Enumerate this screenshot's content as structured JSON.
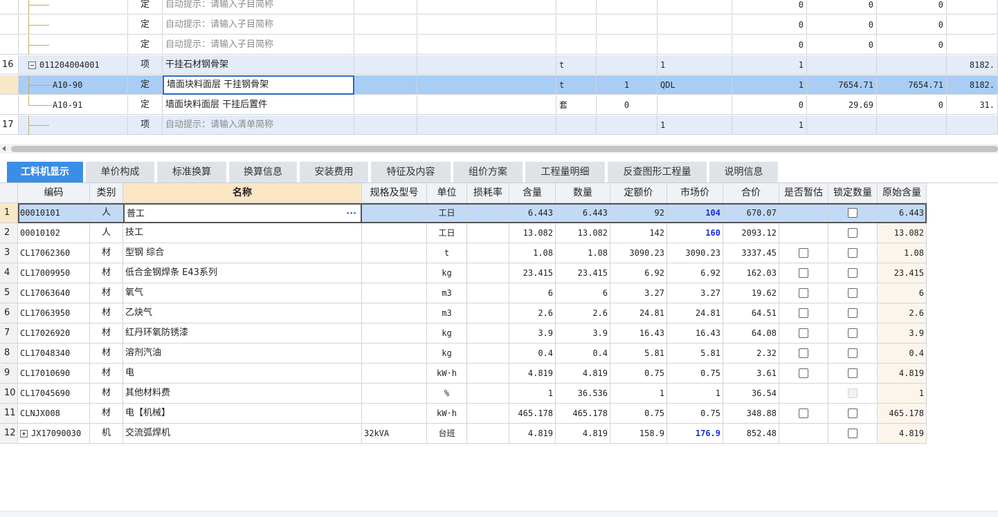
{
  "top_rows": [
    {
      "rn": "",
      "code": "",
      "type": "定",
      "name": "自动提示：请输入子目简称",
      "name_hint": true,
      "unit": "",
      "qty": "",
      "expr": "",
      "c9": "0",
      "c10": "0",
      "c11": "0",
      "c12": "",
      "style": "",
      "tree": "child"
    },
    {
      "rn": "",
      "code": "",
      "type": "定",
      "name": "自动提示：请输入子目简称",
      "name_hint": true,
      "unit": "",
      "qty": "",
      "expr": "",
      "c9": "0",
      "c10": "0",
      "c11": "0",
      "c12": "",
      "style": "",
      "tree": "child"
    },
    {
      "rn": "",
      "code": "",
      "type": "定",
      "name": "自动提示：请输入子目简称",
      "name_hint": true,
      "unit": "",
      "qty": "",
      "expr": "",
      "c9": "0",
      "c10": "0",
      "c11": "0",
      "c12": "",
      "style": "",
      "tree": "child"
    },
    {
      "rn": "16",
      "code": "011204004001",
      "type": "项",
      "name": "干挂石材钢骨架",
      "name_hint": false,
      "unit": "t",
      "qty": "",
      "expr": "1",
      "c9": "1",
      "c10": "",
      "c11": "",
      "c12": "8182.",
      "style": "alt",
      "tree": "parent"
    },
    {
      "rn": "",
      "code": "A10-90",
      "type": "定",
      "name": "墙面块料面层 干挂钢骨架",
      "name_hint": false,
      "unit": "t",
      "qty": "1",
      "expr": "QDL",
      "c9": "1",
      "c10": "7654.71",
      "c11": "7654.71",
      "c12": "8182.",
      "style": "sel",
      "tree": "child2"
    },
    {
      "rn": "",
      "code": "A10-91",
      "type": "定",
      "name": "墙面块料面层 干挂后置件",
      "name_hint": false,
      "unit": "套",
      "qty": "0",
      "expr": "",
      "c9": "0",
      "c10": "29.69",
      "c11": "0",
      "c12": "31.",
      "style": "",
      "tree": "child2"
    },
    {
      "rn": "17",
      "code": "",
      "type": "项",
      "name": "自动提示：请输入清单简称",
      "name_hint": true,
      "unit": "",
      "qty": "",
      "expr": "1",
      "c9": "1",
      "c10": "",
      "c11": "",
      "c12": "",
      "style": "alt",
      "tree": "child"
    }
  ],
  "tabs": [
    "工料机显示",
    "单价构成",
    "标准换算",
    "换算信息",
    "安装费用",
    "特征及内容",
    "组价方案",
    "工程量明细",
    "反查图形工程量",
    "说明信息"
  ],
  "active_tab": "工料机显示",
  "headers": [
    "",
    "编码",
    "类别",
    "名称",
    "规格及型号",
    "单位",
    "损耗率",
    "含量",
    "数量",
    "定额价",
    "市场价",
    "合价",
    "是否暂估",
    "锁定数量",
    "原始含量"
  ],
  "rows": [
    {
      "rn": "1",
      "code": "00010101",
      "cat": "人",
      "name": "普工",
      "spec": "",
      "unit": "工日",
      "loss": "",
      "content": "6.443",
      "qty": "6.443",
      "price": "92",
      "market": "104",
      "total": "670.07",
      "est": "none",
      "lock": "box",
      "orig": "6.443",
      "market_blue": true,
      "expand": false
    },
    {
      "rn": "2",
      "code": "00010102",
      "cat": "人",
      "name": "技工",
      "spec": "",
      "unit": "工日",
      "loss": "",
      "content": "13.082",
      "qty": "13.082",
      "price": "142",
      "market": "160",
      "total": "2093.12",
      "est": "none",
      "lock": "box",
      "orig": "13.082",
      "market_blue": true,
      "expand": false
    },
    {
      "rn": "3",
      "code": "CL17062360",
      "cat": "材",
      "name": "型钢 综合",
      "spec": "",
      "unit": "t",
      "loss": "",
      "content": "1.08",
      "qty": "1.08",
      "price": "3090.23",
      "market": "3090.23",
      "total": "3337.45",
      "est": "box",
      "lock": "box",
      "orig": "1.08",
      "market_blue": false,
      "expand": false
    },
    {
      "rn": "4",
      "code": "CL17009950",
      "cat": "材",
      "name": "低合金钢焊条 E43系列",
      "spec": "",
      "unit": "kg",
      "loss": "",
      "content": "23.415",
      "qty": "23.415",
      "price": "6.92",
      "market": "6.92",
      "total": "162.03",
      "est": "box",
      "lock": "box",
      "orig": "23.415",
      "market_blue": false,
      "expand": false
    },
    {
      "rn": "5",
      "code": "CL17063640",
      "cat": "材",
      "name": "氧气",
      "spec": "",
      "unit": "m3",
      "loss": "",
      "content": "6",
      "qty": "6",
      "price": "3.27",
      "market": "3.27",
      "total": "19.62",
      "est": "box",
      "lock": "box",
      "orig": "6",
      "market_blue": false,
      "expand": false
    },
    {
      "rn": "6",
      "code": "CL17063950",
      "cat": "材",
      "name": "乙炔气",
      "spec": "",
      "unit": "m3",
      "loss": "",
      "content": "2.6",
      "qty": "2.6",
      "price": "24.81",
      "market": "24.81",
      "total": "64.51",
      "est": "box",
      "lock": "box",
      "orig": "2.6",
      "market_blue": false,
      "expand": false
    },
    {
      "rn": "7",
      "code": "CL17026920",
      "cat": "材",
      "name": "红丹环氧防锈漆",
      "spec": "",
      "unit": "kg",
      "loss": "",
      "content": "3.9",
      "qty": "3.9",
      "price": "16.43",
      "market": "16.43",
      "total": "64.08",
      "est": "box",
      "lock": "box",
      "orig": "3.9",
      "market_blue": false,
      "expand": false
    },
    {
      "rn": "8",
      "code": "CL17048340",
      "cat": "材",
      "name": "溶剂汽油",
      "spec": "",
      "unit": "kg",
      "loss": "",
      "content": "0.4",
      "qty": "0.4",
      "price": "5.81",
      "market": "5.81",
      "total": "2.32",
      "est": "box",
      "lock": "box",
      "orig": "0.4",
      "market_blue": false,
      "expand": false
    },
    {
      "rn": "9",
      "code": "CL17010690",
      "cat": "材",
      "name": "电",
      "spec": "",
      "unit": "kW·h",
      "loss": "",
      "content": "4.819",
      "qty": "4.819",
      "price": "0.75",
      "market": "0.75",
      "total": "3.61",
      "est": "box",
      "lock": "box",
      "orig": "4.819",
      "market_blue": false,
      "expand": false
    },
    {
      "rn": "10",
      "code": "CL17045690",
      "cat": "材",
      "name": "其他材料费",
      "spec": "",
      "unit": "%",
      "loss": "",
      "content": "1",
      "qty": "36.536",
      "price": "1",
      "market": "1",
      "total": "36.54",
      "est": "none",
      "lock": "disabled",
      "orig": "1",
      "market_blue": false,
      "expand": false
    },
    {
      "rn": "11",
      "code": "CLNJX008",
      "cat": "材",
      "name": "电【机械】",
      "spec": "",
      "unit": "kW·h",
      "loss": "",
      "content": "465.178",
      "qty": "465.178",
      "price": "0.75",
      "market": "0.75",
      "total": "348.88",
      "est": "box",
      "lock": "box",
      "orig": "465.178",
      "market_blue": false,
      "expand": false
    },
    {
      "rn": "12",
      "code": "JX17090030",
      "cat": "机",
      "name": "交流弧焊机",
      "spec": "32kVA",
      "unit": "台班",
      "loss": "",
      "content": "4.819",
      "qty": "4.819",
      "price": "158.9",
      "market": "176.9",
      "total": "852.48",
      "est": "none",
      "lock": "box",
      "orig": "4.819",
      "market_blue": true,
      "expand": true
    }
  ],
  "edit_button": "···"
}
